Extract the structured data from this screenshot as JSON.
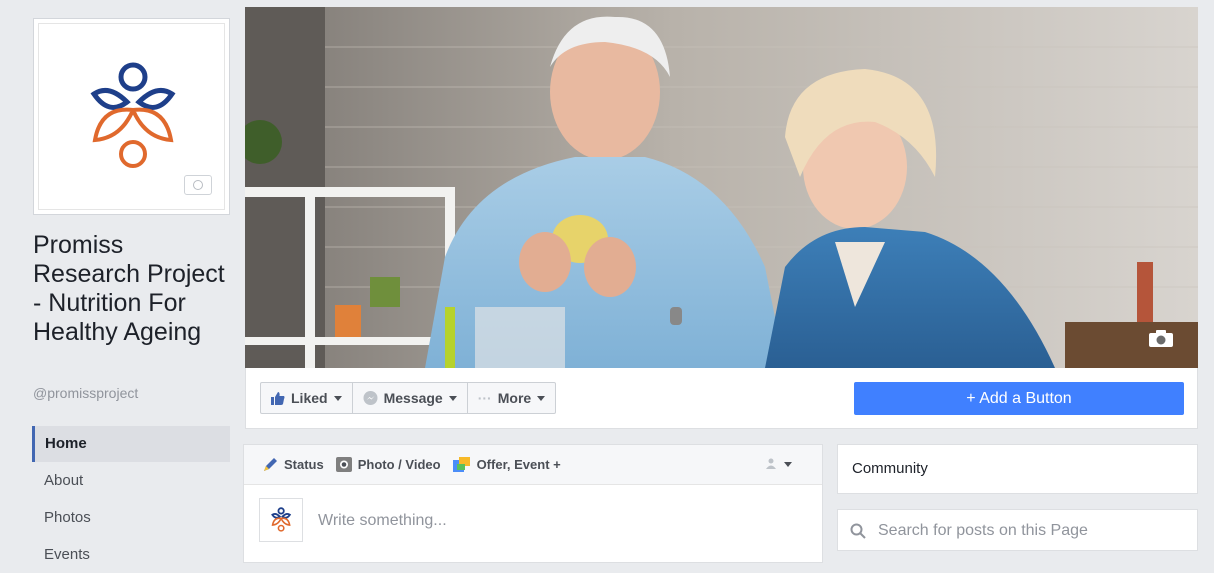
{
  "page": {
    "name": "Promiss Research Project - Nutrition For Healthy Ageing",
    "handle": "@promissproject"
  },
  "nav": {
    "items": [
      {
        "label": "Home",
        "active": true
      },
      {
        "label": "About"
      },
      {
        "label": "Photos"
      },
      {
        "label": "Events"
      }
    ]
  },
  "actions": {
    "liked": "Liked",
    "message": "Message",
    "more": "More",
    "more_prefix": "···",
    "add_button": "+ Add a Button"
  },
  "composer": {
    "tabs": [
      "Status",
      "Photo / Video",
      "Offer, Event +"
    ],
    "placeholder": "Write something..."
  },
  "sidebar": {
    "community": "Community",
    "search_placeholder": "Search for posts on this Page"
  },
  "colors": {
    "brand_blue": "#1e3f8a",
    "brand_orange": "#e0692d",
    "fb_blue": "#4080ff"
  },
  "icons": {
    "liked": "thumbs-up-icon",
    "message": "messenger-icon",
    "status": "pencil-icon",
    "photo": "camera-icon",
    "offer": "offer-icon",
    "search": "search-icon"
  }
}
